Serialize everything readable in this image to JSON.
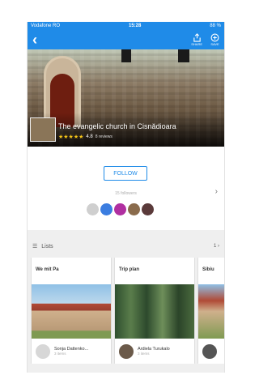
{
  "status": {
    "carrier": "Vodafone RO",
    "time": "15:28",
    "battery": "88 %"
  },
  "nav": {
    "back_icon": "chevron-left-icon",
    "share_label": "SHARE",
    "save_label": "SAVE"
  },
  "hero": {
    "title": "The evangelic church in Cisnădioara",
    "stars": "★★★★★",
    "rating": "4.8",
    "reviews": "8 reviews"
  },
  "follow": {
    "button_label": "FOLLOW",
    "followers": "15 followers"
  },
  "lists": {
    "heading": "Lists",
    "count": "1",
    "cards": [
      {
        "title": "We mit Pa",
        "user": "Sonja Dattenko...",
        "items": "3 items"
      },
      {
        "title": "Trip plan",
        "user": "Ardiela Turukalo",
        "items": "3 items"
      },
      {
        "title": "Sibiu",
        "user": "",
        "items": ""
      }
    ]
  },
  "colors": {
    "accent": "#1f8be8",
    "star": "#f5c518"
  }
}
